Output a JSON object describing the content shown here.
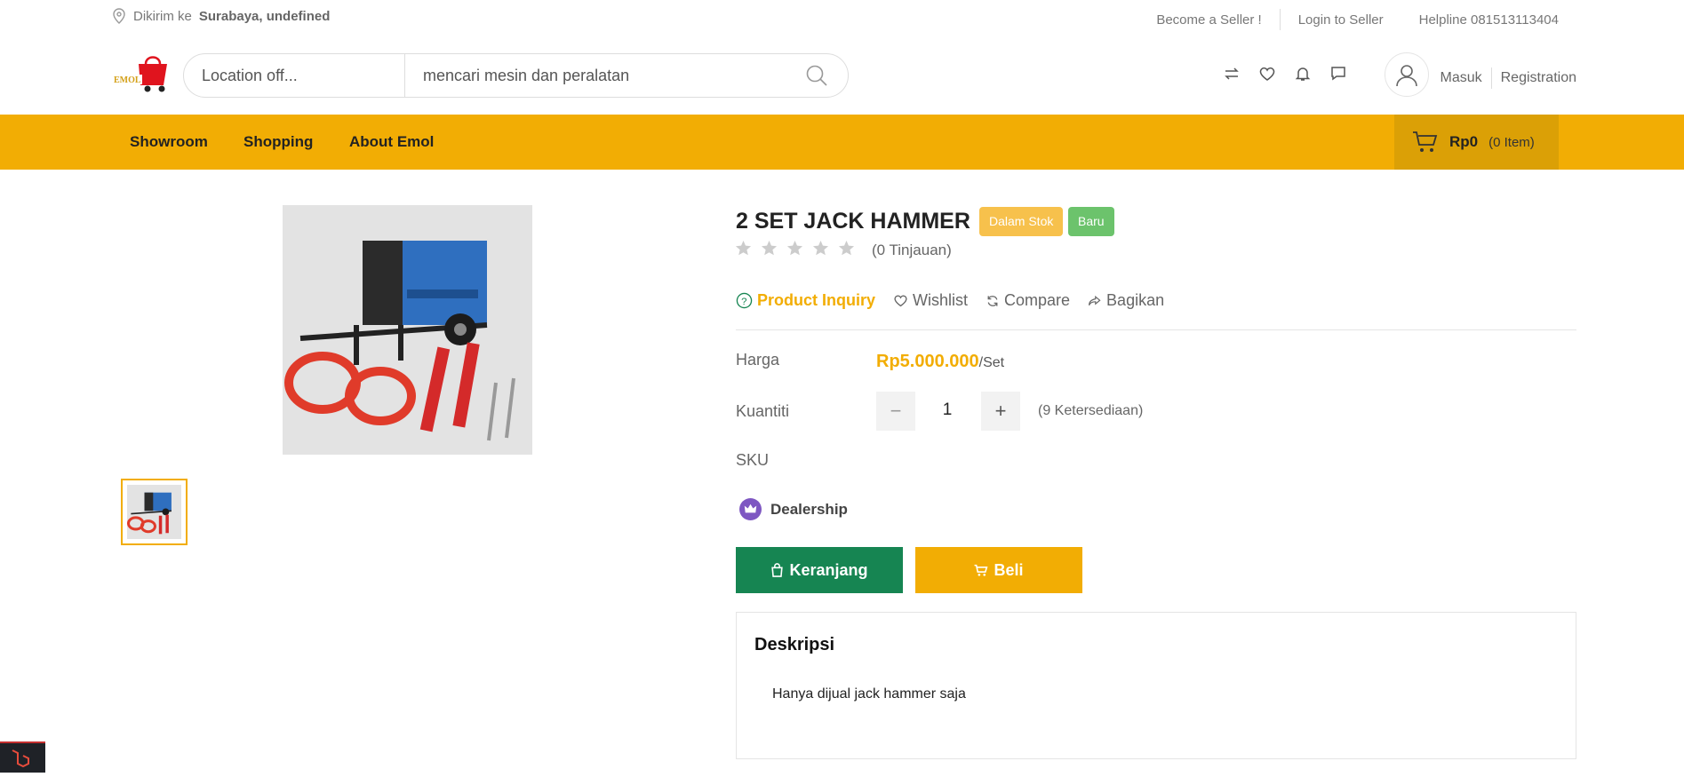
{
  "topbar": {
    "deliver_prefix": "Dikirim ke",
    "deliver_location": "Surabaya, undefined",
    "become_seller": "Become a Seller !",
    "login_seller": "Login to Seller",
    "helpline": "Helpline 081513113404"
  },
  "header": {
    "logo_text": "EMOL",
    "location_placeholder": "Location off...",
    "search_placeholder": "mencari mesin dan peralatan",
    "login": "Masuk",
    "register": "Registration"
  },
  "nav": {
    "items": [
      "Showroom",
      "Shopping",
      "About Emol"
    ],
    "cart_amount": "Rp0",
    "cart_count": "(0 Item)"
  },
  "product": {
    "title": "2 SET JACK HAMMER",
    "badge_stock": "Dalam Stok",
    "badge_new": "Baru",
    "rating": 0,
    "reviews": "(0 Tinjauan)",
    "inquiry": "Product Inquiry",
    "wishlist": "Wishlist",
    "compare": "Compare",
    "share": "Bagikan",
    "price_label": "Harga",
    "price": "Rp5.000.000",
    "price_unit": "/Set",
    "qty_label": "Kuantiti",
    "qty": "1",
    "availability": "(9 Ketersediaan)",
    "sku_label": "SKU",
    "dealer": "Dealership",
    "add_cart": "Keranjang",
    "buy": "Beli",
    "desc_title": "Deskripsi",
    "desc_text": "Hanya dijual jack hammer saja"
  },
  "colors": {
    "accent": "#f2ad04",
    "green": "#168552",
    "badge_stock": "#f7c14c",
    "badge_new": "#6cc36c",
    "dealer_purple": "#7e57c2"
  }
}
